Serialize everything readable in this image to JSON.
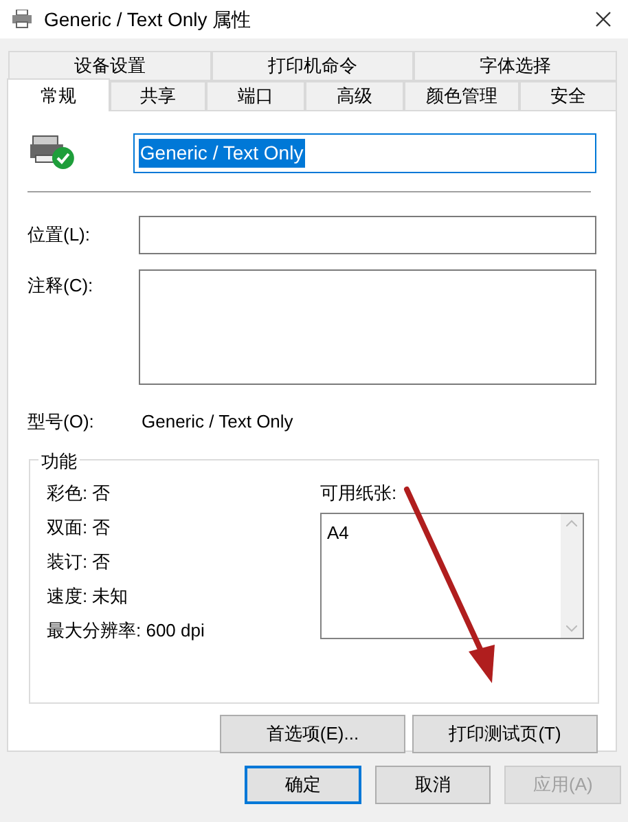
{
  "window": {
    "title": "Generic / Text Only 属性"
  },
  "tab_rows": [
    [
      {
        "label": "设备设置",
        "selected": false
      },
      {
        "label": "打印机命令",
        "selected": false
      },
      {
        "label": "字体选择",
        "selected": false
      }
    ],
    [
      {
        "label": "常规",
        "selected": true
      },
      {
        "label": "共享",
        "selected": false
      },
      {
        "label": "端口",
        "selected": false
      },
      {
        "label": "高级",
        "selected": false
      },
      {
        "label": "颜色管理",
        "selected": false
      },
      {
        "label": "安全",
        "selected": false
      }
    ]
  ],
  "printer_name": {
    "value": "Generic / Text Only",
    "highlighted": true
  },
  "location": {
    "label": "位置(L):"
  },
  "comment": {
    "label": "注释(C):"
  },
  "model": {
    "label": "型号(O):",
    "value": "Generic / Text Only"
  },
  "features": {
    "title": "功能",
    "items": [
      "彩色: 否",
      "双面: 否",
      "装订: 否",
      "速度: 未知",
      "最大分辨率: 600 dpi"
    ],
    "paper_label": "可用纸张:",
    "papers": [
      "A4"
    ]
  },
  "panel_buttons": [
    "首选项(E)...",
    "打印测试页(T)"
  ],
  "dialog_buttons": [
    {
      "label": "确定",
      "default": true,
      "disabled": false
    },
    {
      "label": "取消",
      "default": false,
      "disabled": false
    },
    {
      "label": "应用(A)",
      "default": false,
      "disabled": true
    }
  ]
}
